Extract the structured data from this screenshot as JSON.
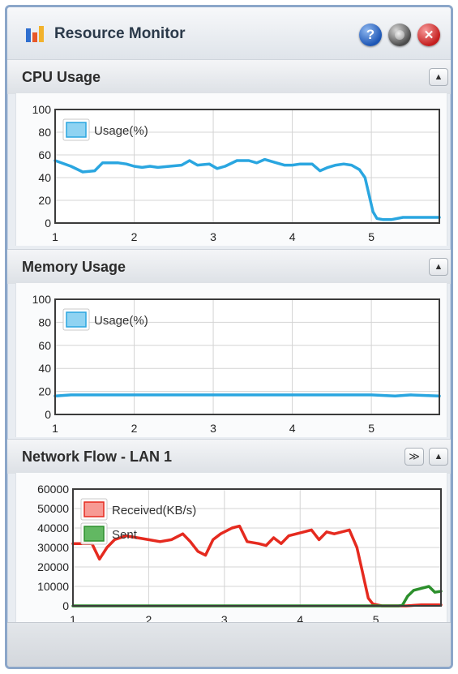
{
  "window": {
    "title": "Resource Monitor",
    "buttons": {
      "help": "?",
      "close": "✕"
    }
  },
  "panels": [
    {
      "id": "cpu",
      "title": "CPU Usage",
      "collapse_icon": "triangle-up-icon",
      "chart_data": {
        "type": "line",
        "x_ticks": [
          "1",
          "2",
          "3",
          "4",
          "5"
        ],
        "y_ticks": [
          "0",
          "20",
          "40",
          "60",
          "80",
          "100"
        ],
        "xlim": [
          1,
          5.86
        ],
        "ylim": [
          0,
          100
        ],
        "grid": true,
        "legend_position": "top-left",
        "series": [
          {
            "name": "Usage(%)",
            "color": "#2aa6e0",
            "fill": "#8fd3f2",
            "x": [
              1,
              1.2,
              1.35,
              1.5,
              1.6,
              1.8,
              1.9,
              2.0,
              2.1,
              2.2,
              2.3,
              2.45,
              2.6,
              2.7,
              2.8,
              2.95,
              3.05,
              3.15,
              3.3,
              3.45,
              3.55,
              3.65,
              3.8,
              3.9,
              4.0,
              4.1,
              4.25,
              4.35,
              4.45,
              4.55,
              4.65,
              4.75,
              4.85,
              4.92,
              4.97,
              5.02,
              5.07,
              5.15,
              5.25,
              5.4,
              5.6,
              5.86
            ],
            "y": [
              55,
              50,
              45,
              46,
              53,
              53,
              52,
              50,
              49,
              50,
              49,
              50,
              51,
              55,
              51,
              52,
              48,
              50,
              55,
              55,
              53,
              56,
              53,
              51,
              51,
              52,
              52,
              46,
              49,
              51,
              52,
              51,
              47,
              40,
              25,
              10,
              4,
              3,
              3,
              5,
              5,
              5
            ]
          }
        ]
      }
    },
    {
      "id": "memory",
      "title": "Memory Usage",
      "collapse_icon": "triangle-up-icon",
      "chart_data": {
        "type": "line",
        "x_ticks": [
          "1",
          "2",
          "3",
          "4",
          "5"
        ],
        "y_ticks": [
          "0",
          "20",
          "40",
          "60",
          "80",
          "100"
        ],
        "xlim": [
          1,
          5.86
        ],
        "ylim": [
          0,
          100
        ],
        "grid": true,
        "legend_position": "top-left",
        "series": [
          {
            "name": "Usage(%)",
            "color": "#2aa6e0",
            "fill": "#8fd3f2",
            "x": [
              1,
              1.2,
              1.5,
              2.0,
              2.5,
              3.0,
              3.5,
              4.0,
              4.5,
              5.0,
              5.3,
              5.5,
              5.86
            ],
            "y": [
              16,
              17,
              17,
              17,
              17,
              17,
              17,
              17,
              17,
              17,
              16,
              17,
              16
            ]
          }
        ]
      }
    },
    {
      "id": "network",
      "title": "Network Flow - LAN 1",
      "expand_icon": "double-chevron-down-icon",
      "collapse_icon": "triangle-up-icon",
      "chart_data": {
        "type": "line",
        "x_ticks": [
          "1",
          "2",
          "3",
          "4",
          "5"
        ],
        "y_ticks": [
          "0",
          "10000",
          "20000",
          "30000",
          "40000",
          "50000",
          "60000"
        ],
        "xlim": [
          1,
          5.86
        ],
        "ylim": [
          0,
          60000
        ],
        "grid": true,
        "legend_position": "top-left",
        "series": [
          {
            "name": "Received(KB/s)",
            "color": "#e52a1f",
            "fill": "#f79a94",
            "x": [
              1,
              1.1,
              1.25,
              1.35,
              1.45,
              1.55,
              1.7,
              1.85,
              2.0,
              2.15,
              2.3,
              2.45,
              2.55,
              2.65,
              2.75,
              2.85,
              2.95,
              3.1,
              3.2,
              3.3,
              3.45,
              3.55,
              3.65,
              3.75,
              3.85,
              3.95,
              4.05,
              4.15,
              4.25,
              4.35,
              4.45,
              4.55,
              4.65,
              4.75,
              4.82,
              4.9,
              4.96,
              5.02,
              5.08,
              5.2,
              5.4,
              5.6,
              5.86
            ],
            "y": [
              32000,
              32000,
              32000,
              24000,
              30000,
              34000,
              36000,
              35000,
              34000,
              33000,
              34000,
              37000,
              33000,
              28000,
              26000,
              34000,
              37000,
              40000,
              41000,
              33000,
              32000,
              31000,
              35000,
              32000,
              36000,
              37000,
              38000,
              39000,
              34000,
              38000,
              37000,
              38000,
              39000,
              30000,
              18000,
              4000,
              1000,
              500,
              0,
              0,
              0,
              500,
              500
            ]
          },
          {
            "name": "Sent",
            "color": "#2c8f2c",
            "fill": "#62b862",
            "x": [
              1,
              1.5,
              2.0,
              2.5,
              3.0,
              3.5,
              4.0,
              4.5,
              5.0,
              5.1,
              5.2,
              5.3,
              5.35,
              5.42,
              5.5,
              5.6,
              5.7,
              5.78,
              5.86
            ],
            "y": [
              0,
              0,
              0,
              0,
              0,
              0,
              0,
              0,
              0,
              0,
              0,
              0,
              300,
              5000,
              8000,
              9000,
              10000,
              7000,
              7500
            ]
          }
        ]
      }
    }
  ]
}
